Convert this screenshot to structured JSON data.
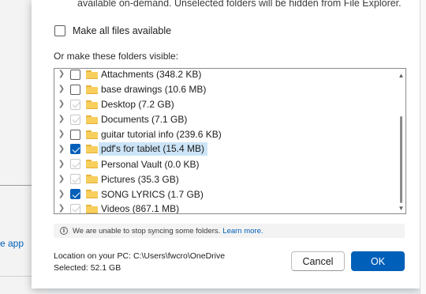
{
  "header": {
    "description_tail": "available on-demand. Unselected folders will be hidden from File Explorer."
  },
  "make_all": {
    "label": "Make all files available",
    "checked": false
  },
  "folders_section": {
    "label": "Or make these folders visible:"
  },
  "folders": [
    {
      "name": "Attachments",
      "size": "(348.2 KB)",
      "state": "unchecked"
    },
    {
      "name": "base drawings",
      "size": "(10.6 MB)",
      "state": "unchecked"
    },
    {
      "name": "Desktop",
      "size": "(7.2 GB)",
      "state": "checked-disabled"
    },
    {
      "name": "Documents",
      "size": "(7.1 GB)",
      "state": "checked-disabled"
    },
    {
      "name": "guitar tutorial info",
      "size": "(239.6 KB)",
      "state": "unchecked"
    },
    {
      "name": "pdf's for tablet",
      "size": "(15.4 MB)",
      "state": "checked",
      "selected": true
    },
    {
      "name": "Personal Vault",
      "size": "(0.0 KB)",
      "state": "checked-disabled"
    },
    {
      "name": "Pictures",
      "size": "(35.3 GB)",
      "state": "checked-disabled"
    },
    {
      "name": "SONG LYRICS",
      "size": "(1.7 GB)",
      "state": "checked"
    },
    {
      "name": "Videos",
      "size": "(867.1 MB)",
      "state": "checked-disabled"
    }
  ],
  "folder_labels": [
    "Attachments  (348.2 KB)",
    "base drawings  (10.6 MB)",
    "Desktop  (7.2 GB)",
    "Documents  (7.1 GB)",
    "guitar tutorial info  (239.6 KB)",
    "pdf's for tablet  (15.4 MB)",
    "Personal Vault  (0.0 KB)",
    "Pictures  (35.3 GB)",
    "SONG LYRICS  (1.7 GB)",
    "Videos  (867.1 MB)"
  ],
  "info": {
    "icon": "info-icon",
    "message": "We are unable to stop syncing some folders.",
    "link": "Learn more."
  },
  "location": {
    "path_line": "Location on your PC: C:\\Users\\fwcro\\OneDrive",
    "selected_line": "Selected: 52.1 GB"
  },
  "buttons": {
    "cancel": "Cancel",
    "ok": "OK"
  },
  "background_window": {
    "link_fragment": "e app"
  },
  "colors": {
    "accent": "#005fb8",
    "selection": "#cce4f7",
    "folder": "#f8cf5c"
  }
}
